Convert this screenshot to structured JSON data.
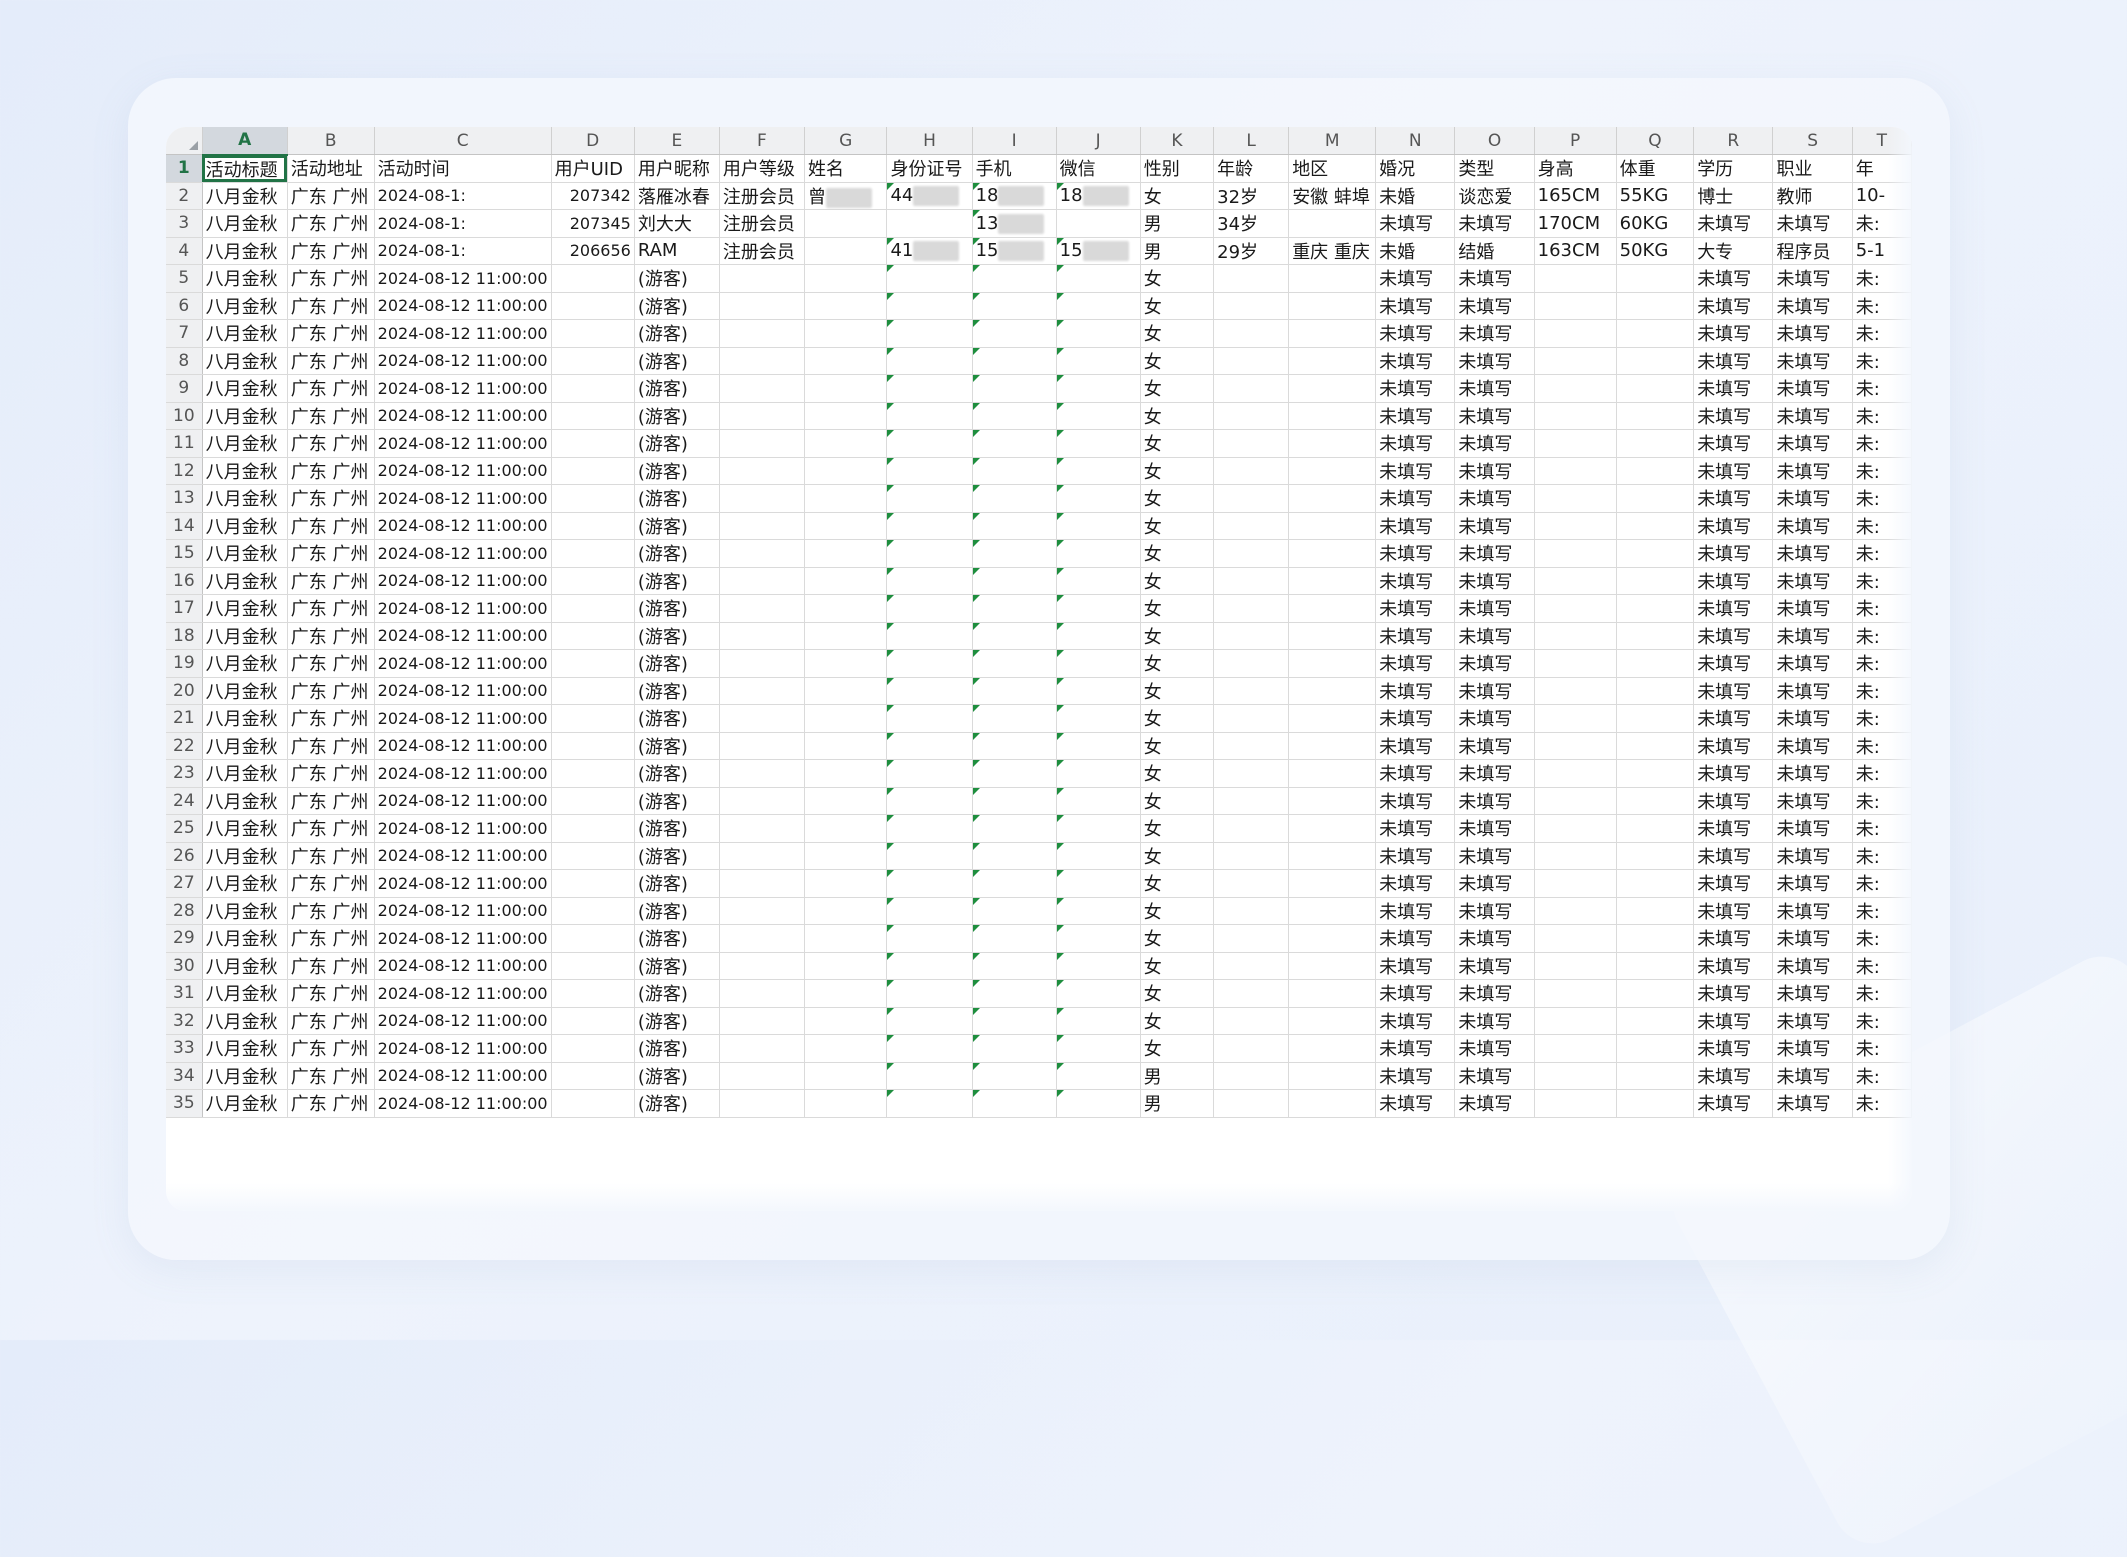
{
  "sheet": {
    "columns": [
      "A",
      "B",
      "C",
      "D",
      "E",
      "F",
      "G",
      "H",
      "I",
      "J",
      "K",
      "L",
      "M",
      "N",
      "O",
      "P",
      "Q",
      "R",
      "S",
      "T"
    ],
    "active_cell": "A1",
    "header_row": [
      "活动标题",
      "活动地址",
      "活动时间",
      "用户UID",
      "用户昵称",
      "用户等级",
      "姓名",
      "身份证号",
      "手机",
      "微信",
      "性别",
      "年龄",
      "地区",
      "婚况",
      "类型",
      "身高",
      "体重",
      "学历",
      "职业",
      "年"
    ],
    "rows": [
      [
        "八月金秋",
        "广东 广州",
        "2024-08-1:",
        "207342",
        "落雁冰春",
        "注册会员",
        "曾",
        "44",
        "18",
        "18",
        "女",
        "32岁",
        "安徽 蚌埠",
        "未婚",
        "谈恋爱",
        "165CM",
        "55KG",
        "博士",
        "教师",
        "10-"
      ],
      [
        "八月金秋",
        "广东 广州",
        "2024-08-1:",
        "207345",
        "刘大大",
        "注册会员",
        "",
        "",
        "13",
        "",
        "男",
        "34岁",
        "",
        "未填写",
        "未填写",
        "170CM",
        "60KG",
        "未填写",
        "未填写",
        "未:"
      ],
      [
        "八月金秋",
        "广东 广州",
        "2024-08-1:",
        "206656",
        "RAM",
        "注册会员",
        "",
        "41",
        "15",
        "15",
        "男",
        "29岁",
        "重庆 重庆",
        "未婚",
        "结婚",
        "163CM",
        "50KG",
        "大专",
        "程序员",
        "5-1"
      ],
      [
        "八月金秋",
        "广东 广州",
        "2024-08-12 11:00:00",
        "",
        "(游客)",
        "",
        "",
        "",
        "",
        "",
        "女",
        "",
        "",
        "未填写",
        "未填写",
        "",
        "",
        "未填写",
        "未填写",
        "未:"
      ],
      [
        "八月金秋",
        "广东 广州",
        "2024-08-12 11:00:00",
        "",
        "(游客)",
        "",
        "",
        "",
        "",
        "",
        "女",
        "",
        "",
        "未填写",
        "未填写",
        "",
        "",
        "未填写",
        "未填写",
        "未:"
      ],
      [
        "八月金秋",
        "广东 广州",
        "2024-08-12 11:00:00",
        "",
        "(游客)",
        "",
        "",
        "",
        "",
        "",
        "女",
        "",
        "",
        "未填写",
        "未填写",
        "",
        "",
        "未填写",
        "未填写",
        "未:"
      ],
      [
        "八月金秋",
        "广东 广州",
        "2024-08-12 11:00:00",
        "",
        "(游客)",
        "",
        "",
        "",
        "",
        "",
        "女",
        "",
        "",
        "未填写",
        "未填写",
        "",
        "",
        "未填写",
        "未填写",
        "未:"
      ],
      [
        "八月金秋",
        "广东 广州",
        "2024-08-12 11:00:00",
        "",
        "(游客)",
        "",
        "",
        "",
        "",
        "",
        "女",
        "",
        "",
        "未填写",
        "未填写",
        "",
        "",
        "未填写",
        "未填写",
        "未:"
      ],
      [
        "八月金秋",
        "广东 广州",
        "2024-08-12 11:00:00",
        "",
        "(游客)",
        "",
        "",
        "",
        "",
        "",
        "女",
        "",
        "",
        "未填写",
        "未填写",
        "",
        "",
        "未填写",
        "未填写",
        "未:"
      ],
      [
        "八月金秋",
        "广东 广州",
        "2024-08-12 11:00:00",
        "",
        "(游客)",
        "",
        "",
        "",
        "",
        "",
        "女",
        "",
        "",
        "未填写",
        "未填写",
        "",
        "",
        "未填写",
        "未填写",
        "未:"
      ],
      [
        "八月金秋",
        "广东 广州",
        "2024-08-12 11:00:00",
        "",
        "(游客)",
        "",
        "",
        "",
        "",
        "",
        "女",
        "",
        "",
        "未填写",
        "未填写",
        "",
        "",
        "未填写",
        "未填写",
        "未:"
      ],
      [
        "八月金秋",
        "广东 广州",
        "2024-08-12 11:00:00",
        "",
        "(游客)",
        "",
        "",
        "",
        "",
        "",
        "女",
        "",
        "",
        "未填写",
        "未填写",
        "",
        "",
        "未填写",
        "未填写",
        "未:"
      ],
      [
        "八月金秋",
        "广东 广州",
        "2024-08-12 11:00:00",
        "",
        "(游客)",
        "",
        "",
        "",
        "",
        "",
        "女",
        "",
        "",
        "未填写",
        "未填写",
        "",
        "",
        "未填写",
        "未填写",
        "未:"
      ],
      [
        "八月金秋",
        "广东 广州",
        "2024-08-12 11:00:00",
        "",
        "(游客)",
        "",
        "",
        "",
        "",
        "",
        "女",
        "",
        "",
        "未填写",
        "未填写",
        "",
        "",
        "未填写",
        "未填写",
        "未:"
      ],
      [
        "八月金秋",
        "广东 广州",
        "2024-08-12 11:00:00",
        "",
        "(游客)",
        "",
        "",
        "",
        "",
        "",
        "女",
        "",
        "",
        "未填写",
        "未填写",
        "",
        "",
        "未填写",
        "未填写",
        "未:"
      ],
      [
        "八月金秋",
        "广东 广州",
        "2024-08-12 11:00:00",
        "",
        "(游客)",
        "",
        "",
        "",
        "",
        "",
        "女",
        "",
        "",
        "未填写",
        "未填写",
        "",
        "",
        "未填写",
        "未填写",
        "未:"
      ],
      [
        "八月金秋",
        "广东 广州",
        "2024-08-12 11:00:00",
        "",
        "(游客)",
        "",
        "",
        "",
        "",
        "",
        "女",
        "",
        "",
        "未填写",
        "未填写",
        "",
        "",
        "未填写",
        "未填写",
        "未:"
      ],
      [
        "八月金秋",
        "广东 广州",
        "2024-08-12 11:00:00",
        "",
        "(游客)",
        "",
        "",
        "",
        "",
        "",
        "女",
        "",
        "",
        "未填写",
        "未填写",
        "",
        "",
        "未填写",
        "未填写",
        "未:"
      ],
      [
        "八月金秋",
        "广东 广州",
        "2024-08-12 11:00:00",
        "",
        "(游客)",
        "",
        "",
        "",
        "",
        "",
        "女",
        "",
        "",
        "未填写",
        "未填写",
        "",
        "",
        "未填写",
        "未填写",
        "未:"
      ],
      [
        "八月金秋",
        "广东 广州",
        "2024-08-12 11:00:00",
        "",
        "(游客)",
        "",
        "",
        "",
        "",
        "",
        "女",
        "",
        "",
        "未填写",
        "未填写",
        "",
        "",
        "未填写",
        "未填写",
        "未:"
      ],
      [
        "八月金秋",
        "广东 广州",
        "2024-08-12 11:00:00",
        "",
        "(游客)",
        "",
        "",
        "",
        "",
        "",
        "女",
        "",
        "",
        "未填写",
        "未填写",
        "",
        "",
        "未填写",
        "未填写",
        "未:"
      ],
      [
        "八月金秋",
        "广东 广州",
        "2024-08-12 11:00:00",
        "",
        "(游客)",
        "",
        "",
        "",
        "",
        "",
        "女",
        "",
        "",
        "未填写",
        "未填写",
        "",
        "",
        "未填写",
        "未填写",
        "未:"
      ],
      [
        "八月金秋",
        "广东 广州",
        "2024-08-12 11:00:00",
        "",
        "(游客)",
        "",
        "",
        "",
        "",
        "",
        "女",
        "",
        "",
        "未填写",
        "未填写",
        "",
        "",
        "未填写",
        "未填写",
        "未:"
      ],
      [
        "八月金秋",
        "广东 广州",
        "2024-08-12 11:00:00",
        "",
        "(游客)",
        "",
        "",
        "",
        "",
        "",
        "女",
        "",
        "",
        "未填写",
        "未填写",
        "",
        "",
        "未填写",
        "未填写",
        "未:"
      ],
      [
        "八月金秋",
        "广东 广州",
        "2024-08-12 11:00:00",
        "",
        "(游客)",
        "",
        "",
        "",
        "",
        "",
        "女",
        "",
        "",
        "未填写",
        "未填写",
        "",
        "",
        "未填写",
        "未填写",
        "未:"
      ],
      [
        "八月金秋",
        "广东 广州",
        "2024-08-12 11:00:00",
        "",
        "(游客)",
        "",
        "",
        "",
        "",
        "",
        "女",
        "",
        "",
        "未填写",
        "未填写",
        "",
        "",
        "未填写",
        "未填写",
        "未:"
      ],
      [
        "八月金秋",
        "广东 广州",
        "2024-08-12 11:00:00",
        "",
        "(游客)",
        "",
        "",
        "",
        "",
        "",
        "女",
        "",
        "",
        "未填写",
        "未填写",
        "",
        "",
        "未填写",
        "未填写",
        "未:"
      ],
      [
        "八月金秋",
        "广东 广州",
        "2024-08-12 11:00:00",
        "",
        "(游客)",
        "",
        "",
        "",
        "",
        "",
        "女",
        "",
        "",
        "未填写",
        "未填写",
        "",
        "",
        "未填写",
        "未填写",
        "未:"
      ],
      [
        "八月金秋",
        "广东 广州",
        "2024-08-12 11:00:00",
        "",
        "(游客)",
        "",
        "",
        "",
        "",
        "",
        "女",
        "",
        "",
        "未填写",
        "未填写",
        "",
        "",
        "未填写",
        "未填写",
        "未:"
      ],
      [
        "八月金秋",
        "广东 广州",
        "2024-08-12 11:00:00",
        "",
        "(游客)",
        "",
        "",
        "",
        "",
        "",
        "女",
        "",
        "",
        "未填写",
        "未填写",
        "",
        "",
        "未填写",
        "未填写",
        "未:"
      ],
      [
        "八月金秋",
        "广东 广州",
        "2024-08-12 11:00:00",
        "",
        "(游客)",
        "",
        "",
        "",
        "",
        "",
        "女",
        "",
        "",
        "未填写",
        "未填写",
        "",
        "",
        "未填写",
        "未填写",
        "未:"
      ],
      [
        "八月金秋",
        "广东 广州",
        "2024-08-12 11:00:00",
        "",
        "(游客)",
        "",
        "",
        "",
        "",
        "",
        "女",
        "",
        "",
        "未填写",
        "未填写",
        "",
        "",
        "未填写",
        "未填写",
        "未:"
      ],
      [
        "八月金秋",
        "广东 广州",
        "2024-08-12 11:00:00",
        "",
        "(游客)",
        "",
        "",
        "",
        "",
        "",
        "男",
        "",
        "",
        "未填写",
        "未填写",
        "",
        "",
        "未填写",
        "未填写",
        "未:"
      ],
      [
        "八月金秋",
        "广东 广州",
        "2024-08-12 11:00:00",
        "",
        "(游客)",
        "",
        "",
        "",
        "",
        "",
        "男",
        "",
        "",
        "未填写",
        "未填写",
        "",
        "",
        "未填写",
        "未填写",
        "未:"
      ]
    ]
  }
}
